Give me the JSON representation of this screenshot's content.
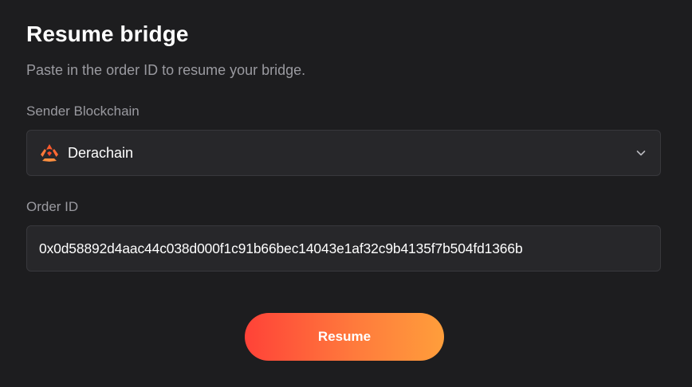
{
  "header": {
    "title": "Resume bridge",
    "subtitle": "Paste in the order ID to resume your bridge."
  },
  "sender": {
    "label": "Sender Blockchain",
    "selected": "Derachain",
    "icon": "derachain-logo-icon",
    "dropdown_icon": "chevron-down-icon"
  },
  "order": {
    "label": "Order ID",
    "value": "0x0d58892d4aac44c038d000f1c91b66bec14043e1af32c9b4135f7b504fd1366b",
    "placeholder": ""
  },
  "actions": {
    "resume_label": "Resume"
  },
  "colors": {
    "background": "#1d1d1f",
    "field_background": "#27272a",
    "button_gradient_start": "#ff4238",
    "button_gradient_end": "#ff9e3b"
  }
}
